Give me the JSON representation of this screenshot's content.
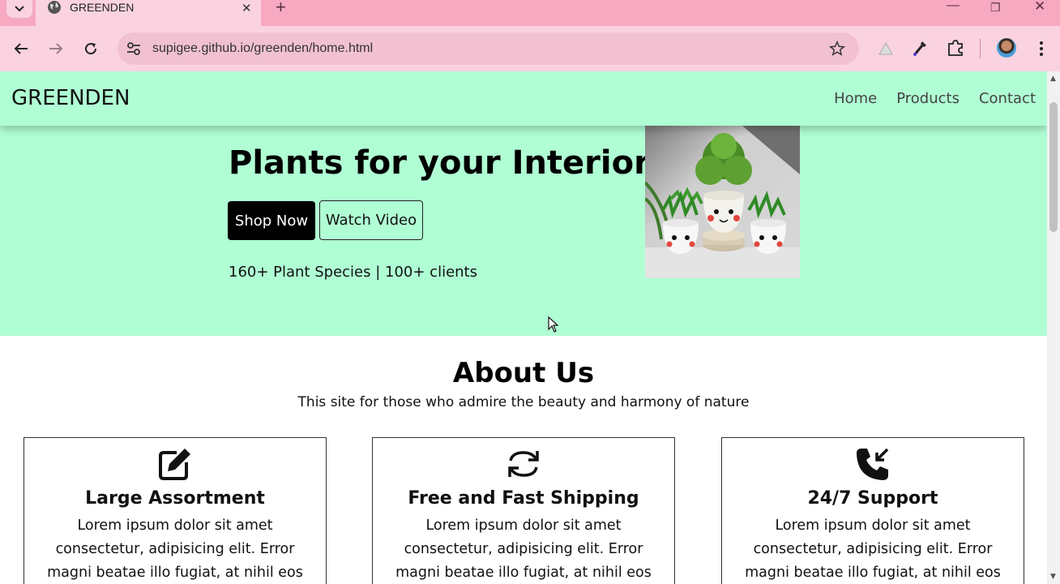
{
  "browser": {
    "tab_title": "GREENDEN",
    "url": "supigee.github.io/greenden/home.html"
  },
  "site": {
    "brand": "GREENDEN",
    "nav": [
      "Home",
      "Products",
      "Contact"
    ]
  },
  "hero": {
    "title": "Plants for your Interior",
    "shop_label": "Shop Now",
    "video_label": "Watch Video",
    "stats": "160+ Plant Species | 100+ clients"
  },
  "about": {
    "title": "About Us",
    "subtitle": "This site for those who admire the beauty and harmony of nature",
    "cards": [
      {
        "icon": "pencil-square-icon",
        "title": "Large Assortment",
        "text": "Lorem ipsum dolor sit amet consectetur, adipisicing elit. Error magni beatae illo fugiat, at nihil eos consectetur"
      },
      {
        "icon": "refresh-arrows-icon",
        "title": "Free and Fast Shipping",
        "text": "Lorem ipsum dolor sit amet consectetur, adipisicing elit. Error magni beatae illo fugiat, at nihil eos consectetur"
      },
      {
        "icon": "phone-incoming-icon",
        "title": "24/7 Support",
        "text": "Lorem ipsum dolor sit amet consectetur, adipisicing elit. Error magni beatae illo fugiat, at nihil eos consectetur"
      }
    ]
  },
  "colors": {
    "hero_bg": "#b0fed4",
    "chrome_tabbar": "#f6a9c1",
    "chrome_toolbar": "#fbd3e0"
  }
}
